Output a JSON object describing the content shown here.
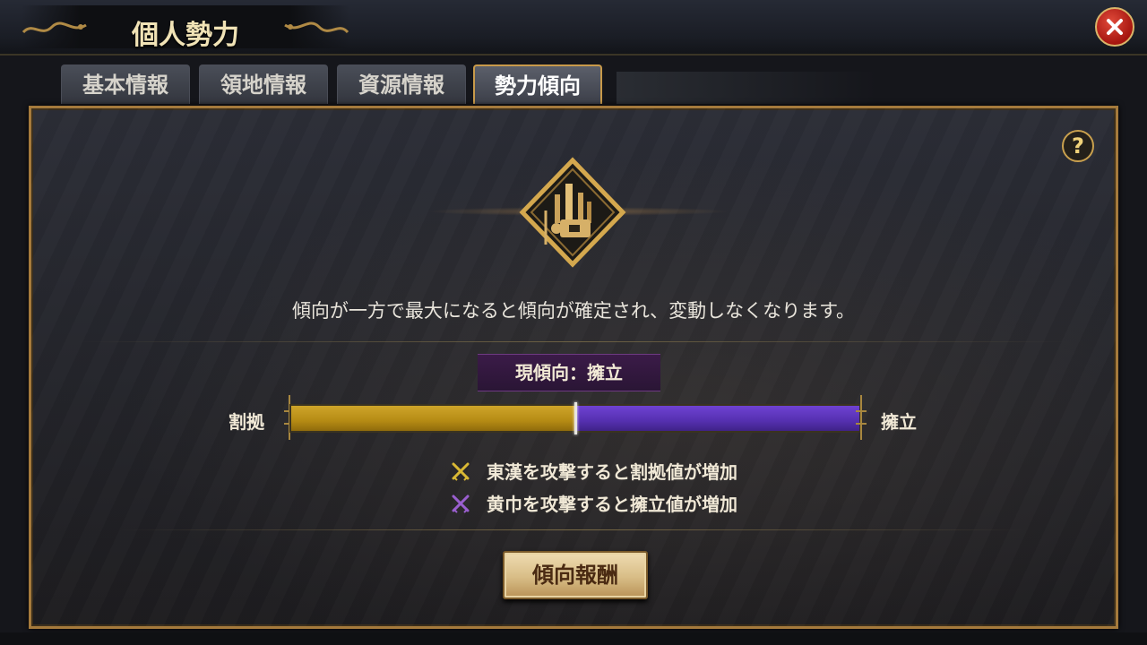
{
  "header": {
    "title": "個人勢力"
  },
  "tabs": [
    {
      "label": "基本情報"
    },
    {
      "label": "領地情報"
    },
    {
      "label": "資源情報"
    },
    {
      "label": "勢力傾向"
    }
  ],
  "active_tab": "勢力傾向",
  "help_label": "?",
  "description": "傾向が一方で最大になると傾向が確定され、変動しなくなります。",
  "current_tendency": "現傾向：擁立",
  "bar": {
    "left_label": "割拠",
    "right_label": "擁立",
    "left_share": 0.5,
    "left_color": "#c29a1e",
    "right_color": "#5f3ac4"
  },
  "legend": [
    {
      "text": "東漢を攻撃すると割拠値が増加",
      "icon": "crossed-swords-gold-icon",
      "color": "#d9b834"
    },
    {
      "text": "黄巾を攻撃すると擁立値が増加",
      "icon": "crossed-swords-purple-icon",
      "color": "#9a5fcf"
    }
  ],
  "reward_button": {
    "label": "傾向報酬"
  },
  "colors": {
    "accent_gold": "#c89a4a",
    "close_red": "#c0241a"
  }
}
